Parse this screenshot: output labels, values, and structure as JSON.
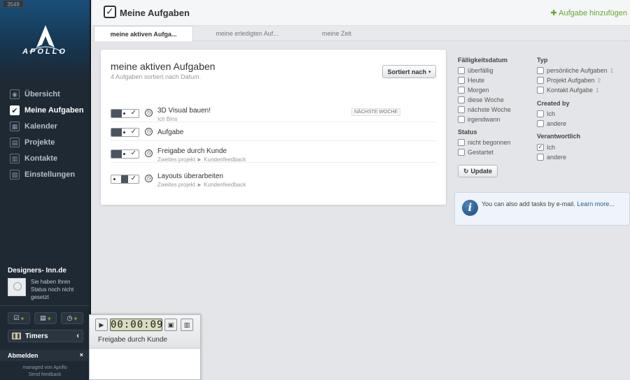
{
  "sidebar": {
    "id_badge": "3549",
    "brand": "APOLLO",
    "nav": [
      {
        "label": "Übersicht",
        "icon": "overview-icon",
        "glyph": "◉"
      },
      {
        "label": "Meine Aufgaben",
        "icon": "check-icon",
        "glyph": "✔"
      },
      {
        "label": "Kalender",
        "icon": "calendar-icon",
        "glyph": "▦"
      },
      {
        "label": "Projekte",
        "icon": "folder-icon",
        "glyph": "▤"
      },
      {
        "label": "Kontakte",
        "icon": "contacts-icon",
        "glyph": "▥"
      },
      {
        "label": "Einstellungen",
        "icon": "settings-icon",
        "glyph": "▧"
      }
    ],
    "org_name": "Designers- Inn.de",
    "status_text": "Sie haben Ihren Status noch nicht gesetzt",
    "timers_label": "Timers",
    "logout_label": "Abmelden",
    "logout_close": "×",
    "managed_by": "managed von Apollo",
    "feedback": "Send feedback"
  },
  "timer_popup": {
    "time": "00:00:09",
    "task_label": "Freigabe durch Kunde"
  },
  "header": {
    "title": "Meine Aufgaben",
    "add_task": "Aufgabe hinzufügen"
  },
  "tabs": [
    {
      "label": "meine aktiven Aufga..."
    },
    {
      "label": "meine erledigten Auf..."
    },
    {
      "label": "meine Zeit"
    }
  ],
  "panel": {
    "title": "meine aktiven Aufgaben",
    "subtitle": "4 Aufgaben sortiert nach Datum.",
    "sort_button": "Sortiert nach",
    "tasks": [
      {
        "title": "3D Visual bauen!",
        "sub": "Ich Bins",
        "tag": "NÄCHSTE WOCHE"
      },
      {
        "title": "Aufgabe",
        "sub": "",
        "tag": ""
      },
      {
        "title": "Freigabe durch Kunde",
        "sub": "Zweites projekt ► Kundenfeedback",
        "tag": ""
      },
      {
        "title": "Layouts überarbeiten",
        "sub": "Zweites projekt ► Kundenfeedback",
        "tag": ""
      }
    ]
  },
  "filters": {
    "due_title": "Fälligkeitsdatum",
    "due": [
      "überfällig",
      "Heute",
      "Morgen",
      "diese Woche",
      "nächste Woche",
      "irgendwann"
    ],
    "status_title": "Status",
    "status": [
      "nicht begonnen",
      "Gestartet"
    ],
    "type_title": "Typ",
    "types": [
      {
        "label": "persönliche Aufgaben",
        "count": "1"
      },
      {
        "label": "Projekt Aufgaben",
        "count": "2"
      },
      {
        "label": "Kontakt Aufgabe",
        "count": "1"
      }
    ],
    "created_title": "Created by",
    "created": [
      "Ich",
      "andere"
    ],
    "resp_title": "Verantwortlich",
    "resp": [
      "Ich",
      "andere"
    ],
    "update_button": "Update"
  },
  "info": {
    "text": "You can also add tasks by e-mail.",
    "link": "Learn more..."
  }
}
